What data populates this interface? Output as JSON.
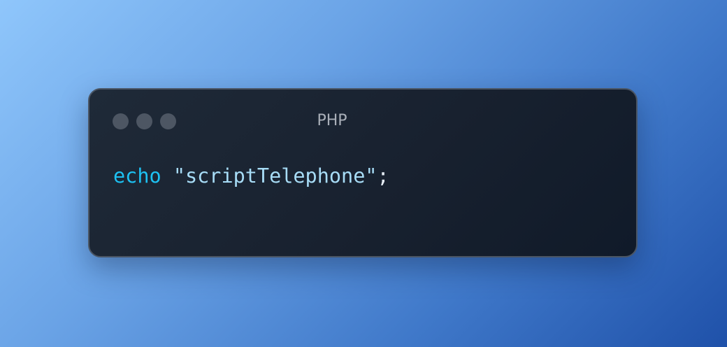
{
  "window": {
    "title": "PHP",
    "controls": [
      {
        "name": "close",
        "color": "#4d5663"
      },
      {
        "name": "minimize",
        "color": "#4d5663"
      },
      {
        "name": "zoom",
        "color": "#4d5663"
      }
    ]
  },
  "code": {
    "keyword": "echo",
    "space": " ",
    "string": "\"scriptTelephone\"",
    "terminator": ";"
  },
  "colors": {
    "keyword": "#1dc1f2",
    "string": "#a7dcf6",
    "window_bg": "#18212f",
    "background_start": "#8fc6fb",
    "background_end": "#1f51a9"
  }
}
